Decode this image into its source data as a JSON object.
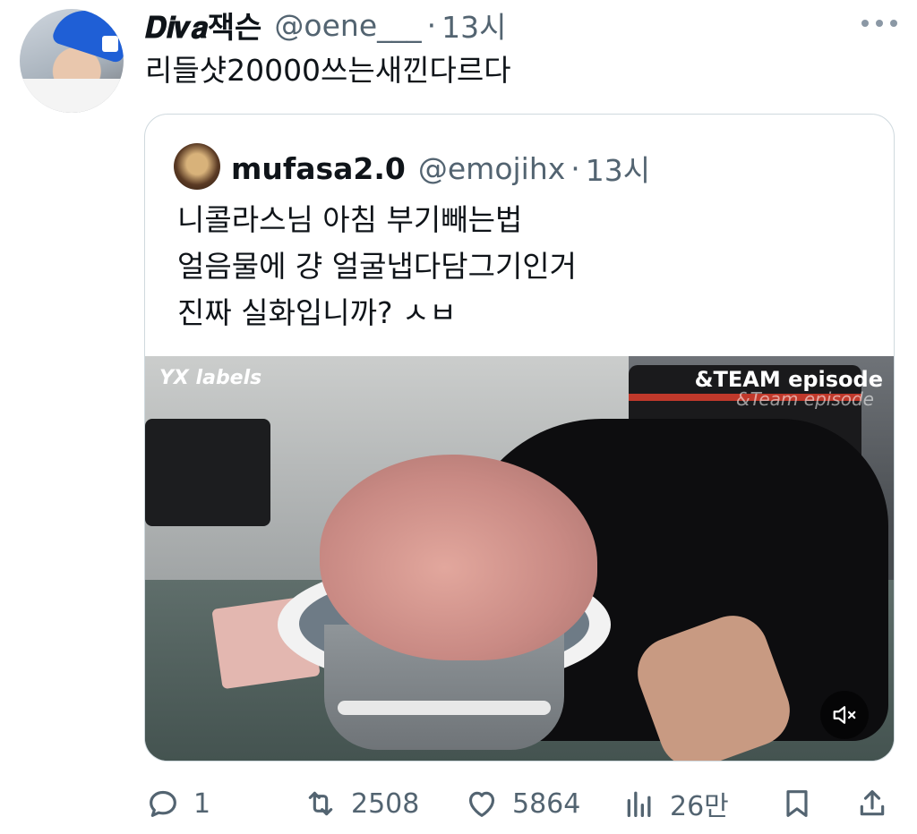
{
  "tweet": {
    "display_name": "𝑫𝒊𝒗𝒂잭슨",
    "handle": "@oene___",
    "separator": "·",
    "time": "13시",
    "text": "리들샷20000쓰는새낀다르다"
  },
  "quote": {
    "display_name": "mufasa2.0",
    "handle": "@emojihx",
    "separator": "·",
    "time": "13시",
    "lines": [
      "니콜라스님 아침 부기빼는법",
      "얼음물에 걍 얼굴냅다담그기인거",
      "진짜 실화입니까? ㅅㅂ"
    ],
    "media": {
      "watermark_left": "YX labels",
      "watermark_right": "&TEAM episode",
      "watermark_right_sub": "&Team episode"
    }
  },
  "actions": {
    "reply_count": "1",
    "retweet_count": "2508",
    "like_count": "5864",
    "views_count": "26만"
  },
  "colors": {
    "text": "#0f1419",
    "secondary": "#536471",
    "border": "#cfd9de"
  }
}
